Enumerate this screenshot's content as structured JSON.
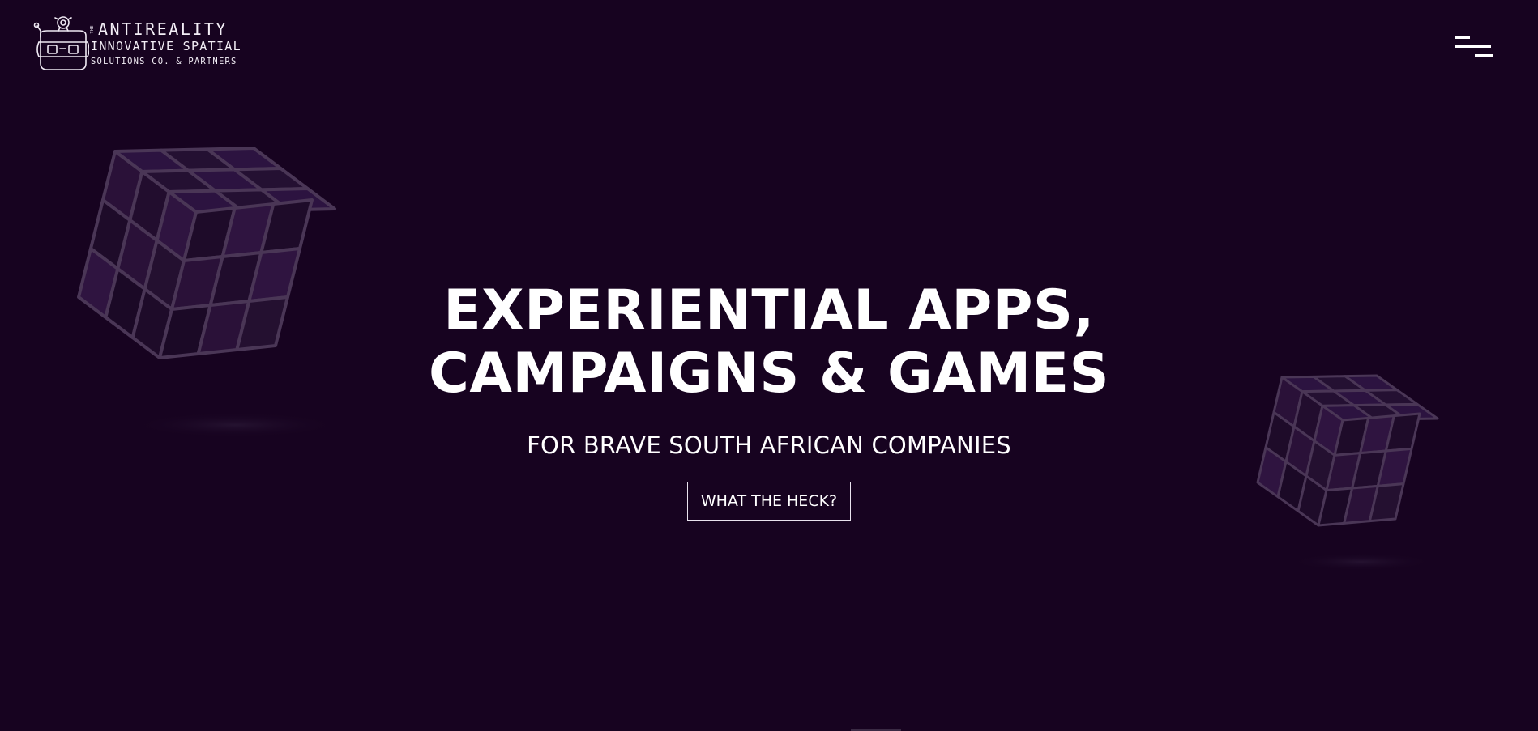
{
  "header": {
    "logo": {
      "small_label": "THE",
      "brand": "ANTIREALITY",
      "line2": "INNOVATIVE SPATIAL",
      "line3": "SOLUTIONS CO. & PARTNERS"
    },
    "menu_icon": "hamburger-menu-icon"
  },
  "hero": {
    "title_line1": "EXPERIENTIAL APPS,",
    "title_line2": "CAMPAIGNS & GAMES",
    "subtitle": "FOR BRAVE SOUTH AFRICAN COMPANIES",
    "cta_label": "WHAT THE HECK?"
  },
  "decorations": {
    "left_cube": "rubiks-cube-icon",
    "right_cube": "rubiks-cube-icon"
  },
  "colors": {
    "background": "#170320",
    "text": "#ffffff",
    "cube_face": "#2a1138",
    "cube_edge": "#4a3656"
  }
}
